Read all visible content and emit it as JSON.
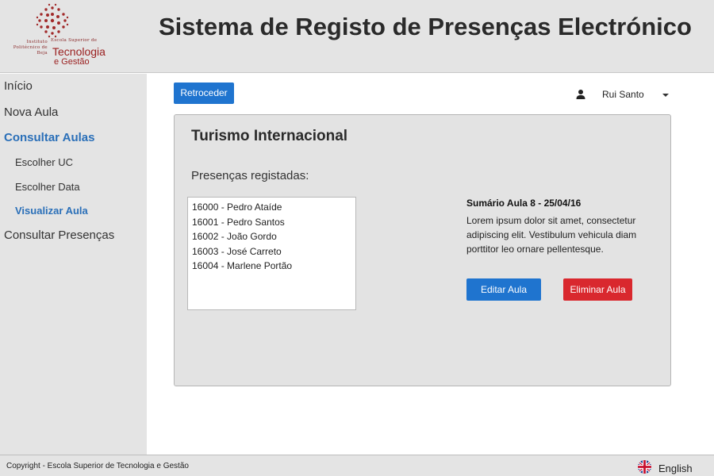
{
  "header": {
    "title": "Sistema de Registo de Presenças Electrónico",
    "logo": {
      "line1": "Instituto Politécnico de Beja",
      "line2": "Escola Superior de",
      "line3": "Tecnologia",
      "line4": "e Gestão"
    }
  },
  "sidebar": {
    "items": [
      {
        "label": "Início"
      },
      {
        "label": "Nova Aula"
      },
      {
        "label": "Consultar Aulas"
      },
      {
        "label": "Escolher UC"
      },
      {
        "label": "Escolher Data"
      },
      {
        "label": "Visualizar Aula"
      },
      {
        "label": "Consultar Presenças"
      }
    ]
  },
  "toolbar": {
    "back_label": "Retroceder",
    "user_name": "Rui Santo",
    "user_icon": "person-icon"
  },
  "card": {
    "title": "Turismo Internacional",
    "presences_label": "Presenças registadas:",
    "students": [
      "16000 - Pedro Ataíde",
      "16001 - Pedro Santos",
      "16002 - João Gordo",
      "16003 - José Carreto",
      "16004 - Marlene Portão"
    ],
    "summary_title": "Sumário Aula 8 - 25/04/16",
    "summary_text": "Lorem ipsum dolor sit amet, consectetur adipiscing elit. Vestibulum vehicula diam porttitor leo ornare pellentesque.",
    "edit_label": "Editar Aula",
    "delete_label": "Eliminar Aula"
  },
  "footer": {
    "copyright": "Copyright - Escola Superior de Tecnologia e Gestão",
    "language": "English"
  },
  "colors": {
    "primary": "#1f74cf",
    "danger": "#d9282e",
    "active_nav": "#2a6fb8",
    "panel_bg": "#e4e4e4"
  }
}
